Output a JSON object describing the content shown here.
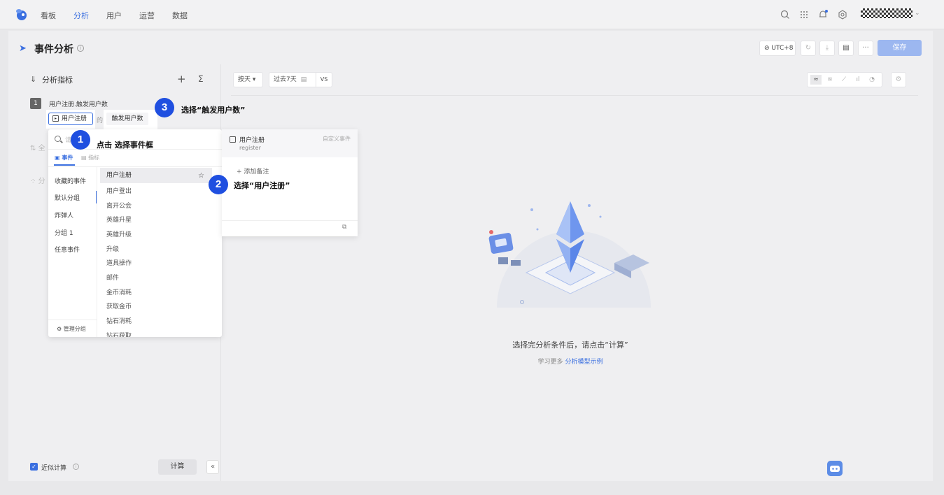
{
  "nav": {
    "items": [
      "看板",
      "分析",
      "用户",
      "运营",
      "数据"
    ],
    "active_index": 1
  },
  "header": {
    "title": "事件分析",
    "timezone": "UTC+8",
    "save_label": "保存",
    "more_label": "···"
  },
  "left_panel": {
    "title": "分析指标",
    "plus": "+",
    "sigma": "Σ",
    "metric": {
      "index": "1",
      "name": "用户注册.触发用户数",
      "event": "用户注册",
      "connector": "的",
      "indicator": "触发用户数"
    },
    "ghost_rows": [
      "全",
      "分"
    ],
    "approx_label": "近似计算",
    "calc_label": "计算",
    "collapse": "«"
  },
  "dropdown": {
    "search_placeholder": "请",
    "tabs": [
      "事件",
      "指标"
    ],
    "groups": [
      "收藏的事件",
      "默认分组",
      "炸弹人",
      "分组 1",
      "任意事件"
    ],
    "active_group": 1,
    "manage_label": "管理分组",
    "events": [
      "用户注册",
      "用户登出",
      "离开公会",
      "英雄升星",
      "英雄升级",
      "升级",
      "道具操作",
      "邮件",
      "金币消耗",
      "获取金币",
      "钻石消耗",
      "钻石获取"
    ]
  },
  "preview": {
    "name": "用户注册",
    "code": "register",
    "tag": "自定义事件",
    "add_note": "添加备注"
  },
  "toolbar": {
    "granularity": "按天 ▾",
    "range": "过去7天",
    "vs": "VS"
  },
  "empty": {
    "message": "选择完分析条件后，请点击“计算”",
    "learn_prefix": "学习更多",
    "learn_link": "分析模型示例"
  },
  "annotations": [
    {
      "num": "1",
      "text": "点击 选择事件框"
    },
    {
      "num": "2",
      "text": "选择“用户注册”"
    },
    {
      "num": "3",
      "text": "选择“触发用户数”"
    }
  ],
  "colors": {
    "accent": "#3a6fe0",
    "badge": "#1f4fe0",
    "save_disabled": "#9cb7f0"
  }
}
